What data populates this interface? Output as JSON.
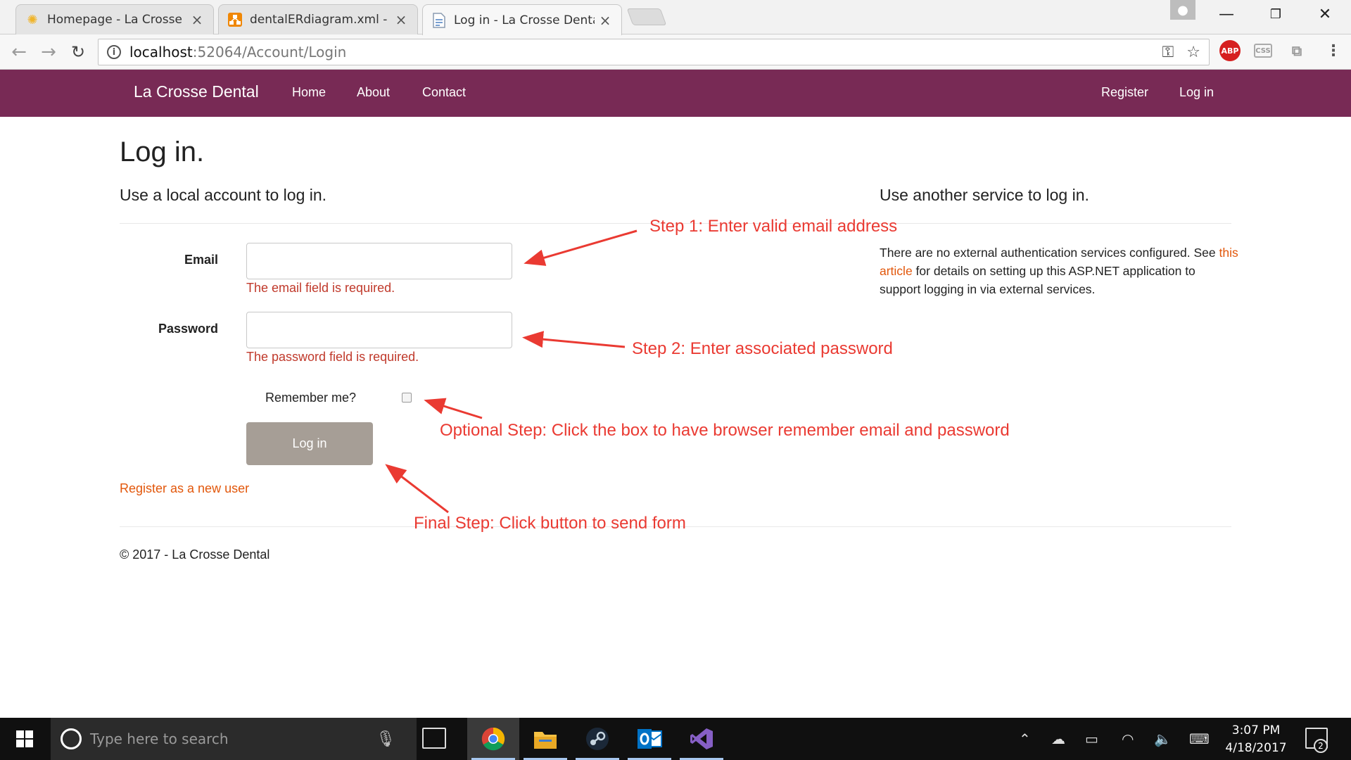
{
  "browser": {
    "tabs": [
      {
        "title": "Homepage - La Crosse",
        "icon": "sun-favicon-icon",
        "active": false
      },
      {
        "title": "dentalERdiagram.xml - d",
        "icon": "drawio-favicon-icon",
        "active": false
      },
      {
        "title": "Log in - La Crosse Dental",
        "icon": "page-favicon-icon",
        "active": true
      }
    ],
    "url_host": "localhost",
    "url_path": ":52064/Account/Login",
    "extensions": {
      "abp": "ABP",
      "css": "CSS"
    }
  },
  "site": {
    "brand": "La Crosse Dental",
    "nav": {
      "home": "Home",
      "about": "About",
      "contact": "Contact",
      "register": "Register",
      "login": "Log in"
    },
    "nav_color": "#782a55"
  },
  "page": {
    "title": "Log in.",
    "local_heading": "Use a local account to log in.",
    "external_heading": "Use another service to log in.",
    "email_label": "Email",
    "email_value": "",
    "email_error": "The email field is required.",
    "password_label": "Password",
    "password_value": "",
    "password_error": "The password field is required.",
    "remember_label": "Remember me?",
    "remember_checked": false,
    "login_button": "Log in",
    "register_link": "Register as a new user",
    "external_text_1": "There are no external authentication services configured. See ",
    "external_link": "this article",
    "external_text_2": " for details on setting up this ASP.NET application to support logging in via external services.",
    "footer": "© 2017 - La Crosse Dental"
  },
  "annotations": {
    "step1": "Step 1: Enter valid email address",
    "step2": "Step 2: Enter associated password",
    "optional": "Optional Step: Click the box to have browser remember email and password",
    "final": "Final Step: Click button to send form",
    "color": "#ea3a32"
  },
  "taskbar": {
    "search_placeholder": "Type here to search",
    "time": "3:07 PM",
    "date": "4/18/2017",
    "notification_count": "2",
    "pinned": [
      "chrome-icon",
      "file-explorer-icon",
      "steam-icon",
      "outlook-icon",
      "visual-studio-icon"
    ]
  }
}
